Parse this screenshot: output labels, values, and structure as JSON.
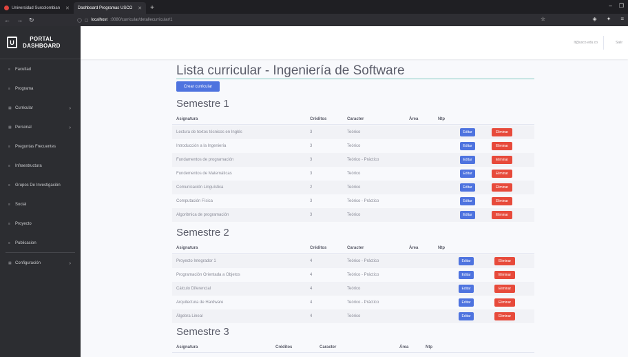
{
  "browser": {
    "tabs": [
      {
        "label": "Universidad Surcolombian"
      },
      {
        "label": "Dashboard Programas USCO"
      }
    ],
    "url_host": "localhost",
    "url_path": ":8080/curricular/detallecurricular/1"
  },
  "sidebar": {
    "brand_line1": "PORTAL",
    "brand_line2": "DASHBOARD",
    "items": [
      {
        "label": "Facultad"
      },
      {
        "label": "Programa"
      },
      {
        "label": "Curricular"
      },
      {
        "label": "Personal"
      },
      {
        "label": "Preguntas Frecuentes"
      },
      {
        "label": "Infraestructura"
      },
      {
        "label": "Grupos De Investigación"
      },
      {
        "label": "Social"
      },
      {
        "label": "Proyecto"
      },
      {
        "label": "Publicacion"
      },
      {
        "label": "Configuración"
      }
    ]
  },
  "topbar": {
    "user_email": "lt@usco.edu.co",
    "logout_label": "Salir"
  },
  "main": {
    "title": "Lista curricular - Ingeniería de Software",
    "create_button": "Crear curricular",
    "headers": {
      "asignatura": "Asignatura",
      "creditos": "Créditos",
      "caracter": "Caracter",
      "area": "Área",
      "ntp": "Ntp"
    },
    "edit_label": "Editar",
    "delete_label": "Eliminar",
    "semesters": [
      {
        "title": "Semestre 1",
        "rows": [
          {
            "asignatura": "Lectura de textos técnicos en Inglés",
            "creditos": "3",
            "caracter": "Teórico"
          },
          {
            "asignatura": "Introducción a la Ingeniería",
            "creditos": "3",
            "caracter": "Teórico"
          },
          {
            "asignatura": "Fundamentos de programación",
            "creditos": "3",
            "caracter": "Teórico - Práctico"
          },
          {
            "asignatura": "Fundementos de Matemáticas",
            "creditos": "3",
            "caracter": "Teórico"
          },
          {
            "asignatura": "Comunicación Linguística",
            "creditos": "2",
            "caracter": "Teórico"
          },
          {
            "asignatura": "Computación Física",
            "creditos": "3",
            "caracter": "Teórico - Práctico"
          },
          {
            "asignatura": "Algoritmica de programación",
            "creditos": "3",
            "caracter": "Teórico"
          }
        ]
      },
      {
        "title": "Semestre 2",
        "rows": [
          {
            "asignatura": "Proyecto Integrador 1",
            "creditos": "4",
            "caracter": "Teórico - Práctico"
          },
          {
            "asignatura": "Programación Orientada a Objetos",
            "creditos": "4",
            "caracter": "Teórico - Práctico"
          },
          {
            "asignatura": "Cálculo Diferencial",
            "creditos": "4",
            "caracter": "Teórico"
          },
          {
            "asignatura": "Arquitectura de Hardware",
            "creditos": "4",
            "caracter": "Teórico - Práctico"
          },
          {
            "asignatura": "Álgebra Lineal",
            "creditos": "4",
            "caracter": "Teórico"
          }
        ]
      },
      {
        "title": "Semestre 3",
        "rows": []
      }
    ]
  }
}
